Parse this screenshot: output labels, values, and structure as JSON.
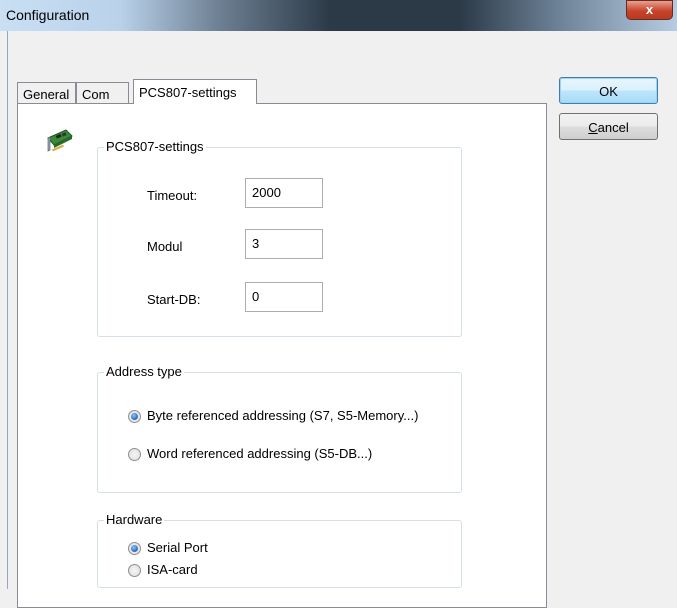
{
  "window": {
    "title": "Configuration",
    "close_glyph": "x"
  },
  "tabs": [
    {
      "label": "General"
    },
    {
      "label": "Com"
    },
    {
      "label": "PCS807-settings"
    }
  ],
  "settings_group": {
    "legend": "PCS807-settings",
    "timeout_label": "Timeout:",
    "timeout_value": "2000",
    "modul_label": "Modul",
    "modul_value": "3",
    "startdb_label": "Start-DB:",
    "startdb_value": "0"
  },
  "address_group": {
    "legend": "Address type",
    "options": [
      {
        "label": "Byte referenced addressing (S7, S5-Memory...)",
        "selected": true
      },
      {
        "label": "Word referenced addressing (S5-DB...)",
        "selected": false
      }
    ]
  },
  "hardware_group": {
    "legend": "Hardware",
    "options": [
      {
        "label": "Serial Port",
        "selected": true
      },
      {
        "label": "ISA-card",
        "selected": false
      }
    ]
  },
  "buttons": {
    "ok": "OK",
    "cancel_prefix": "C",
    "cancel_rest": "ancel"
  },
  "icons": {
    "panel_icon": "pci-card-icon"
  }
}
